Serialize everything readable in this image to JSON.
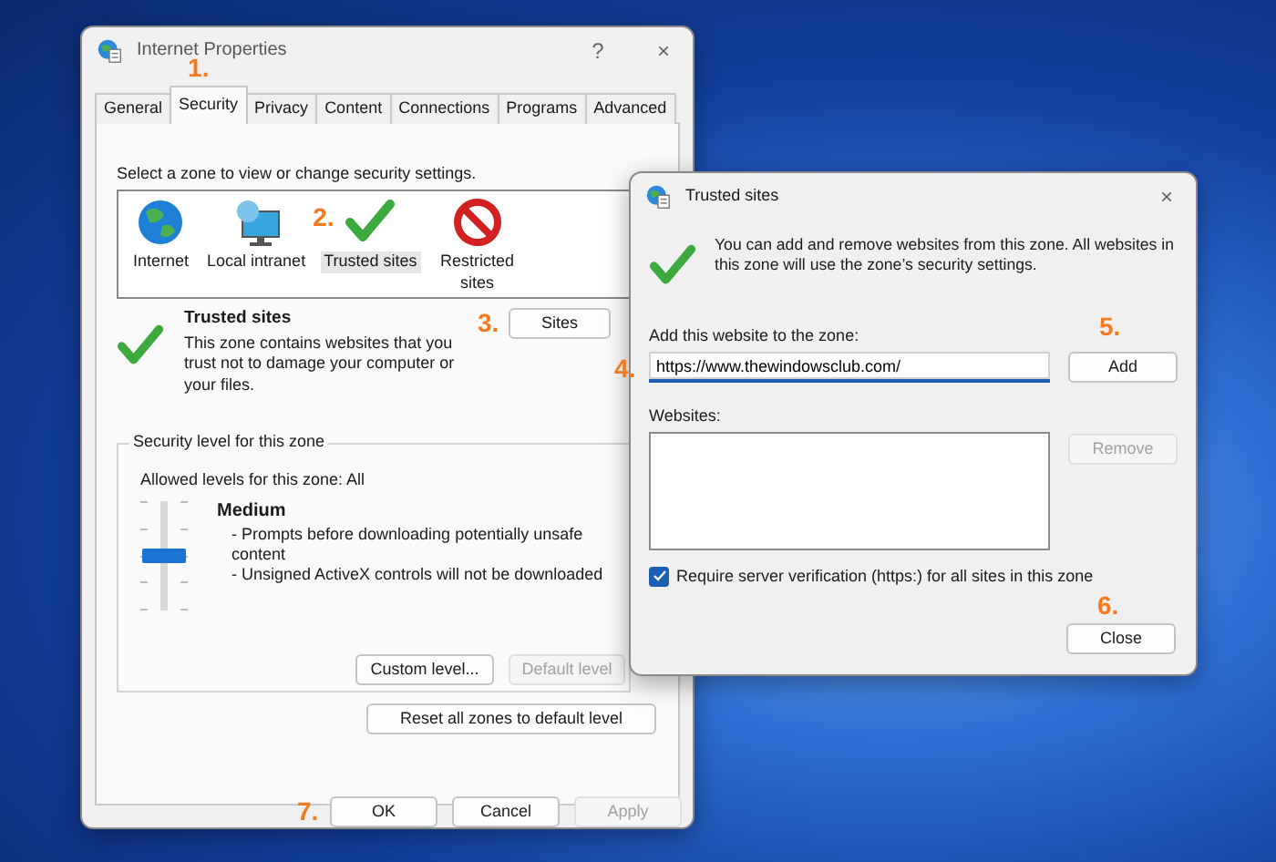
{
  "main_window": {
    "title": "Internet Properties",
    "help": "?",
    "close": "×",
    "tabs": [
      {
        "label": "General",
        "selected": false
      },
      {
        "label": "Security",
        "selected": true,
        "step": "1."
      },
      {
        "label": "Privacy",
        "selected": false
      },
      {
        "label": "Content",
        "selected": false
      },
      {
        "label": "Connections",
        "selected": false
      },
      {
        "label": "Programs",
        "selected": false
      },
      {
        "label": "Advanced",
        "selected": false
      }
    ],
    "zone_prompt": "Select a zone to view or change security settings.",
    "zones": [
      {
        "label": "Internet",
        "kind": "globe",
        "selected": false
      },
      {
        "label": "Local intranet",
        "kind": "intranet",
        "selected": false
      },
      {
        "label": "Trusted sites",
        "kind": "trusted",
        "selected": true,
        "step": "2."
      },
      {
        "label": "Restricted sites",
        "kind": "restricted",
        "selected": false
      }
    ],
    "zone_info": {
      "title": "Trusted sites",
      "description": "This zone contains websites that you trust not to damage your computer or your files."
    },
    "sites_button": {
      "label": "Sites",
      "disabled": false,
      "step": "3."
    },
    "security_level": {
      "legend": "Security level for this zone",
      "allowed": "Allowed levels for this zone: All",
      "level": 0.5,
      "name": "Medium",
      "details": [
        "- Prompts before downloading potentially unsafe content",
        "- Unsigned ActiveX controls will not be downloaded"
      ]
    },
    "custom_level_button": {
      "label": "Custom level...",
      "disabled": false
    },
    "default_level_button": {
      "label": "Default level",
      "disabled": true
    },
    "reset_button": {
      "label": "Reset all zones to default level",
      "disabled": false
    },
    "footer_buttons": [
      {
        "label": "OK",
        "disabled": false,
        "step": "7."
      },
      {
        "label": "Cancel",
        "disabled": false
      },
      {
        "label": "Apply",
        "disabled": true
      }
    ]
  },
  "trusted_dialog": {
    "title": "Trusted sites",
    "close": "×",
    "description": "You can add and remove websites from this zone. All websites in this zone will use the zone’s security settings.",
    "add_label": "Add this website to the zone:",
    "add_value": "https://www.thewindowsclub.com/",
    "add_step": "4.",
    "add_button": {
      "label": "Add",
      "disabled": false,
      "step": "5."
    },
    "websites_label": "Websites:",
    "remove_button": {
      "label": "Remove",
      "disabled": true
    },
    "require_https": {
      "label": "Require server verification (https:) for all sites in this zone",
      "checked": true
    },
    "close_button": {
      "label": "Close",
      "disabled": false,
      "step": "6."
    }
  }
}
